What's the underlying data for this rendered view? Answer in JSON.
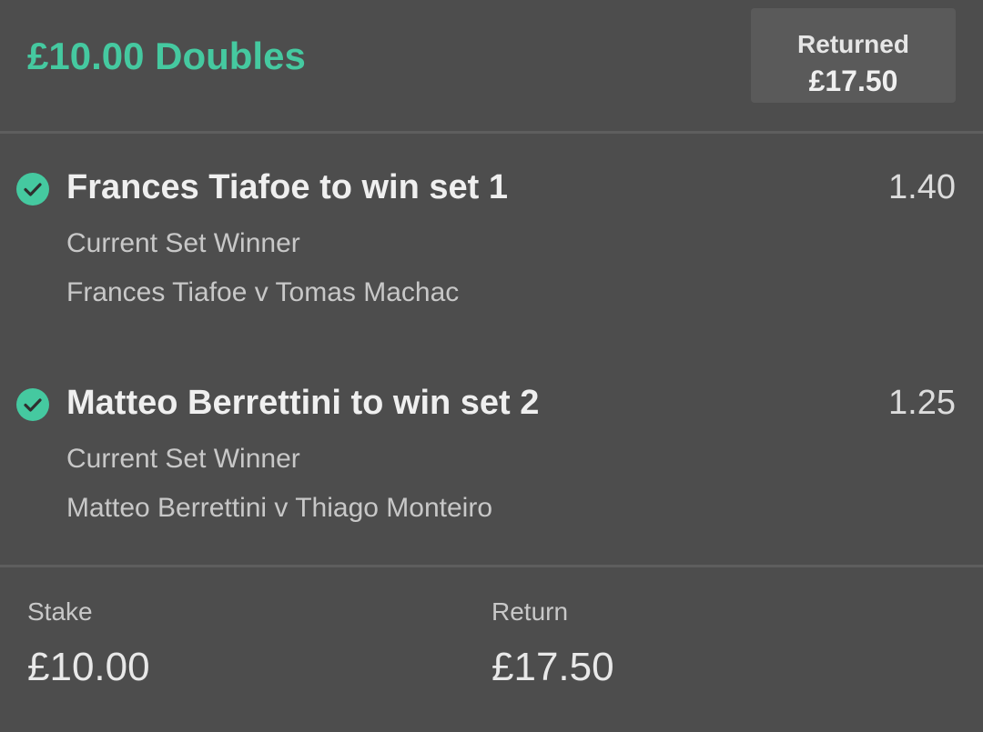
{
  "header": {
    "bet_title": "£10.00 Doubles",
    "returned_label": "Returned",
    "returned_amount": "£17.50"
  },
  "selections": [
    {
      "name": "Frances Tiafoe to win set 1",
      "odds": "1.40",
      "market": "Current Set Winner",
      "event": "Frances Tiafoe v Tomas Machac",
      "status_icon": "check-circle-icon"
    },
    {
      "name": "Matteo Berrettini to win set 2",
      "odds": "1.25",
      "market": "Current Set Winner",
      "event": "Matteo Berrettini v Thiago Monteiro",
      "status_icon": "check-circle-icon"
    }
  ],
  "footer": {
    "stake_label": "Stake",
    "stake_value": "£10.00",
    "return_label": "Return",
    "return_value": "£17.50"
  },
  "colors": {
    "accent": "#45c9a0",
    "background": "#4d4d4d",
    "returned_box": "#5a5a5a"
  }
}
